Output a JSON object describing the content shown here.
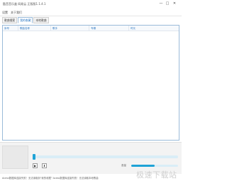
{
  "window": {
    "title": "酷音音乐盒 网易云 正版版1.1.4.1",
    "min_glyph": "—",
    "max_glyph": "□",
    "close_glyph": "✕"
  },
  "menu": [
    {
      "label": "设置"
    },
    {
      "label": "关于我们"
    }
  ],
  "tabs": [
    {
      "label": "歌曲搜索",
      "active": false
    },
    {
      "label": "我的收藏",
      "active": true
    },
    {
      "label": "本地歌曲",
      "active": false
    }
  ],
  "table": {
    "headers": [
      "序号",
      "歌曲名称",
      "歌手",
      "专辑",
      "时长"
    ]
  },
  "player": {
    "play_glyph": "▶",
    "download_glyph": "⬇",
    "progress_fraction": 0.02,
    "volume_label": "音量",
    "volume_fraction": 0.5
  },
  "status": {
    "text": "Acess数据库连接失败！无法读取到\"我的收藏\" Acess数据库连接失败！无法读取本地歌曲"
  },
  "watermark": {
    "text": "极速下载站"
  },
  "colors": {
    "accent": "#1fa3d6",
    "header_text": "#2d77c2",
    "border": "#9bbbd9"
  }
}
